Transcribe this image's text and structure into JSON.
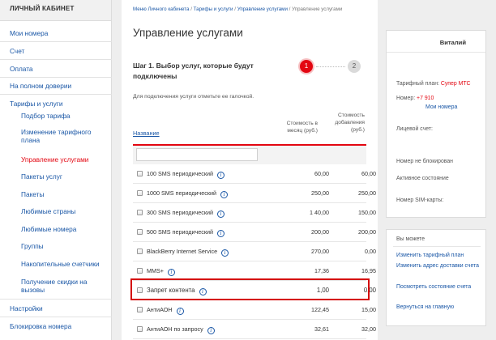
{
  "sidebar": {
    "header": "ЛИЧНЫЙ КАБИНЕТ",
    "items": [
      {
        "label": "Мои номера"
      },
      {
        "label": "Счет"
      },
      {
        "label": "Оплата"
      },
      {
        "label": "На полном доверии"
      },
      {
        "label": "Тарифы и услуги"
      },
      {
        "label": "Подбор тарифа"
      },
      {
        "label": "Изменение тарифного плана"
      },
      {
        "label": "Управление услугами"
      },
      {
        "label": "Пакеты услуг"
      },
      {
        "label": "Пакеты"
      },
      {
        "label": "Любимые страны"
      },
      {
        "label": "Любимые номера"
      },
      {
        "label": "Группы"
      },
      {
        "label": "Накопительные счетчики"
      },
      {
        "label": "Получение скидки на вызовы"
      },
      {
        "label": "Настройки"
      },
      {
        "label": "Блокировка номера"
      }
    ]
  },
  "breadcrumb": {
    "items": [
      "Меню Личного кабинета",
      "Тарифы и услуги",
      "Управление услугами"
    ],
    "separator": "/",
    "current": "Управление услугами"
  },
  "main": {
    "title": "Управление услугами",
    "step_title": "Шаг 1. Выбор услуг, которые будут подключены",
    "step1": "1",
    "step2": "2",
    "hint": "Для подключения услуги отметьте ее галочкой.",
    "columns": {
      "name": "Название",
      "price": "Стоимость в месяц (руб.)",
      "add": "Стоимость добавления (руб.)"
    },
    "rows": [
      {
        "name": "100 SMS периодический",
        "price": "60,00",
        "add": "60,00"
      },
      {
        "name": "1000 SMS периодический",
        "price": "250,00",
        "add": "250,00"
      },
      {
        "name": "300 SMS периодический",
        "price": "1 40,00",
        "add": "150,00"
      },
      {
        "name": "500 SMS периодический",
        "price": "200,00",
        "add": "200,00"
      },
      {
        "name": "BlackBerry Internet Service",
        "price": "270,00",
        "add": "0,00"
      },
      {
        "name": "MMS+",
        "price": "17,36",
        "add": "16,95"
      },
      {
        "name": "Запрет контента",
        "price": "1,00",
        "add": "0,00"
      },
      {
        "name": "АнтиАОН",
        "price": "122,45",
        "add": "15,00"
      },
      {
        "name": "АнтиАОН по запросу",
        "price": "32,61",
        "add": "32,00"
      }
    ]
  },
  "profile": {
    "name": "Виталий",
    "tariff_label": "Тарифный план:",
    "tariff_value": "Супер МТС",
    "number_label": "Номер:",
    "number_value": "+7 910",
    "my_numbers_link": "Мои номера",
    "account_label": "Лицевой счет:",
    "not_blocked": "Номер не блокирован",
    "active_state": "Активное состояние",
    "sim_label": "Номер SIM-карты:"
  },
  "actions": {
    "title": "Вы можете",
    "links": [
      "Изменить тарифный план",
      "Изменить адрес доставки счета",
      "Посмотреть состояние счета",
      "Вернуться на главную"
    ]
  },
  "colors": {
    "accent_red": "#e30611",
    "link_blue": "#1a57a6"
  },
  "icons": {
    "info": "info-icon"
  }
}
